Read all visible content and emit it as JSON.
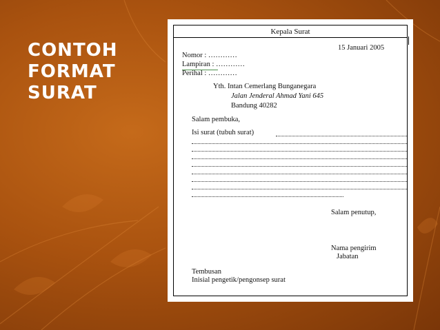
{
  "slide": {
    "title_lines": [
      "CONTOH",
      "FORMAT",
      "SURAT"
    ]
  },
  "letter": {
    "header": "Kepala Surat",
    "date": "15 Januari 2005",
    "nomor": "Nomor   : …………",
    "lampiran": "Lampiran : …………",
    "perihal": "Perihal   : …………",
    "recipient": [
      "Yth. Intan Cemerlang Bunganegara",
      "Jalan Jenderal Ahmad Yani 645",
      "Bandung 40282"
    ],
    "greeting": "Salam pembuka,",
    "body_label": "Isi surat (tubuh surat)",
    "closing": "Salam penutup,",
    "sender_name": "Nama pengirim",
    "sender_title": "Jabatan",
    "cc": "Tembusan",
    "initials": "Inisial pengetik/pengonsep surat"
  },
  "colors": {
    "background": "#a9520f",
    "title_text": "#ffffff",
    "paper": "#ffffff"
  }
}
